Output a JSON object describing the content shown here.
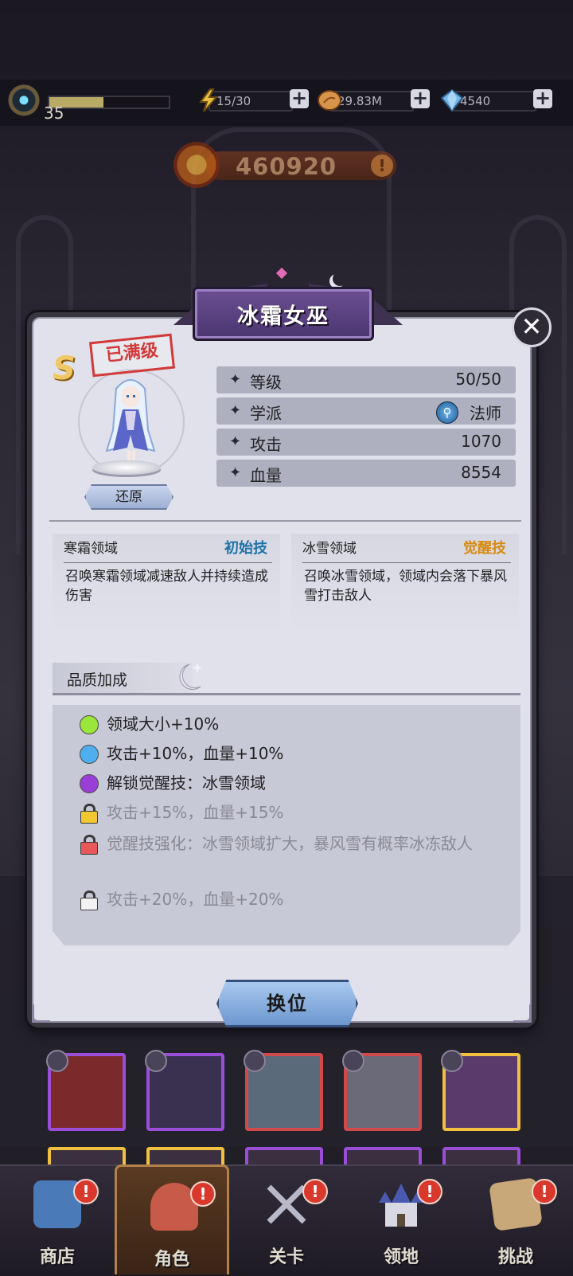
{
  "header": {
    "player_level": "35",
    "xp_progress": 0.45,
    "energy": "15/30",
    "gold": "29.83M",
    "gems": "4540",
    "power": "460920",
    "power_info": "!"
  },
  "hero": {
    "name": "冰霜女巫",
    "grade": "S",
    "max_level_stamp": "已满级",
    "restore_button": "还原",
    "stats": [
      {
        "label": "等级",
        "value": "50/50"
      },
      {
        "label": "学派",
        "value": "法师"
      },
      {
        "label": "攻击",
        "value": "1070"
      },
      {
        "label": "血量",
        "value": "8554"
      }
    ],
    "stat_star": "✦"
  },
  "skills": [
    {
      "name": "寒霜领域",
      "tag": "初始技",
      "tag_color": "#1e73a8",
      "desc": "召唤寒霜领域减速敌人并持续造成伤害"
    },
    {
      "name": "冰雪领域",
      "tag": "觉醒技",
      "tag_color": "#d98a10",
      "desc": "召唤冰雪领域，领域内会落下暴风雪打击敌人"
    }
  ],
  "quality": {
    "title": "品质加成",
    "items": [
      {
        "text": "领域大小+10%",
        "state": "unlocked",
        "color": "#9be63a"
      },
      {
        "text": "攻击+10%，血量+10%",
        "state": "unlocked",
        "color": "#4eaef0"
      },
      {
        "text": "解锁觉醒技：冰雪领域",
        "state": "unlocked",
        "color": "#9a3ed8"
      },
      {
        "text": "攻击+15%，血量+15%",
        "state": "locked",
        "color": "#f2c832"
      },
      {
        "text": "觉醒技强化：冰雪领域扩大，暴风雪有概率冰冻敌人",
        "state": "locked",
        "color": "#e85858"
      },
      {
        "text": "攻击+20%，血量+20%",
        "state": "locked",
        "color": "#f2f2f2"
      }
    ]
  },
  "actions": {
    "swap_button": "换位",
    "close": "✕"
  },
  "roster": [
    {
      "border": "#9a4ed8",
      "bg": "#7a2a2a"
    },
    {
      "border": "#9a4ed8",
      "bg": "#3a3050"
    },
    {
      "border": "#d04a4a",
      "bg": "#5a6a7a"
    },
    {
      "border": "#d04a4a",
      "bg": "#6a6a78"
    },
    {
      "border": "#f0c040",
      "bg": "#5a3a6a"
    }
  ],
  "nav": [
    {
      "label": "商店",
      "badge": "!",
      "icon_color": "#4a7ab8"
    },
    {
      "label": "角色",
      "badge": "!",
      "icon_color": "#c85a4a"
    },
    {
      "label": "关卡",
      "badge": "!",
      "icon_color": "#8a8aa0"
    },
    {
      "label": "领地",
      "badge": "!",
      "icon_color": "#5a6ab0"
    },
    {
      "label": "挑战",
      "badge": "!",
      "icon_color": "#c8a878"
    }
  ],
  "active_nav": "角色"
}
